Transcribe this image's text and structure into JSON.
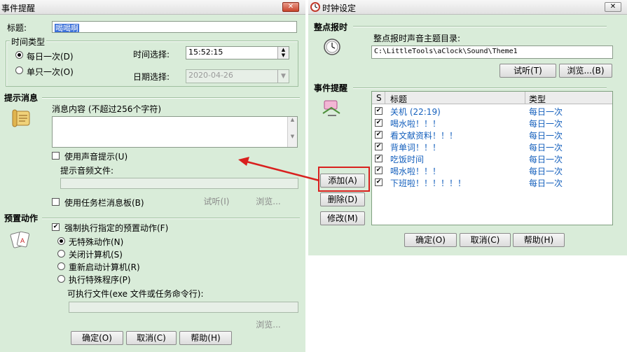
{
  "colors": {
    "window_bg": "#d9ecd9",
    "link_blue": "#1560bd",
    "annotation_red": "#d9201e"
  },
  "left_window": {
    "title": "事件提醒",
    "close_symbol": "✕",
    "title_label": "标题:",
    "title_value": "喝喝啊",
    "time_type_group": "时间类型",
    "radio_daily": "每日一次(D)",
    "radio_once": "单只一次(O)",
    "time_select_label": "时间选择:",
    "time_value": "15:52:15",
    "date_select_label": "日期选择:",
    "date_value": "2020-04-26",
    "prompt_section": "提示消息",
    "message_label": "消息内容 (不超过256个字符)",
    "message_value": "",
    "use_sound_label": "使用声音提示(U)",
    "sound_file_label": "提示音频文件:",
    "use_taskbar_label": "使用任务栏消息板(B)",
    "listen_button": "试听(I)",
    "browse_button_1": "浏览...",
    "preset_section": "预置动作",
    "force_action_label": "强制执行指定的预置动作(F)",
    "radio_no_action": "无特殊动作(N)",
    "radio_shutdown": "关闭计算机(S)",
    "radio_restart": "重新启动计算机(R)",
    "radio_exec": "执行特殊程序(P)",
    "exec_file_label": "可执行文件(exe 文件或任务命令行):",
    "browse_button_2": "浏览...",
    "ok_button": "确定(O)",
    "cancel_button": "取消(C)",
    "help_button": "帮助(H)"
  },
  "right_window": {
    "title": "时钟设定",
    "close_symbol": "✕",
    "chime_section": "整点报时",
    "chime_dir_label": "整点报时声音主题目录:",
    "chime_dir_value": "C:\\LittleTools\\aClock\\Sound\\Theme1",
    "listen_button": "试听(T)",
    "browse_button": "浏览...(B)",
    "event_section": "事件提醒",
    "add_button": "添加(A)",
    "delete_button": "删除(D)",
    "modify_button": "修改(M)",
    "table_headers": {
      "s": "S",
      "title": "标题",
      "type": "类型"
    },
    "events": [
      {
        "title": "关机 (22:19)",
        "type": "每日一次",
        "checked": true
      },
      {
        "title": "喝水啦！！！",
        "type": "每日一次",
        "checked": true
      },
      {
        "title": "看文献资料！！！",
        "type": "每日一次",
        "checked": true
      },
      {
        "title": "背单词！！！",
        "type": "每日一次",
        "checked": true
      },
      {
        "title": "吃饭时间",
        "type": "每日一次",
        "checked": true
      },
      {
        "title": "喝水啦！！！",
        "type": "每日一次",
        "checked": true
      },
      {
        "title": "下班啦！！！！！！",
        "type": "每日一次",
        "checked": true
      }
    ],
    "ok_button": "确定(O)",
    "cancel_button": "取消(C)",
    "help_button": "帮助(H)"
  }
}
